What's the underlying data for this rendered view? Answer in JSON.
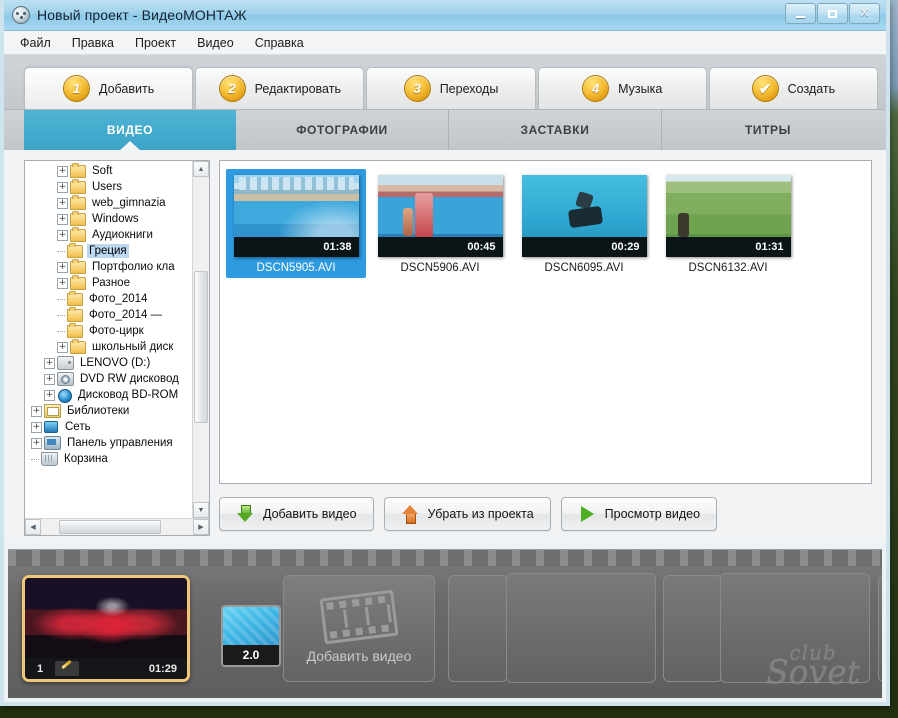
{
  "window": {
    "title": "Новый проект - ВидеоМОНТАЖ",
    "icon": "app-icon",
    "controls": {
      "minimize": "–",
      "maximize": "□",
      "close": "X"
    }
  },
  "menubar": {
    "items": [
      "Файл",
      "Правка",
      "Проект",
      "Видео",
      "Справка"
    ]
  },
  "step_tabs": [
    {
      "num": "1",
      "label": "Добавить",
      "active": true
    },
    {
      "num": "2",
      "label": "Редактировать",
      "active": false
    },
    {
      "num": "3",
      "label": "Переходы",
      "active": false
    },
    {
      "num": "4",
      "label": "Музыка",
      "active": false
    },
    {
      "num": "✔",
      "label": "Создать",
      "active": false
    }
  ],
  "category_tabs": [
    {
      "label": "ВИДЕО",
      "active": true
    },
    {
      "label": "ФОТОГРАФИИ",
      "active": false
    },
    {
      "label": "ЗАСТАВКИ",
      "active": false
    },
    {
      "label": "ТИТРЫ",
      "active": false
    }
  ],
  "tree": {
    "nodes": [
      {
        "label": "Soft",
        "indent": 3,
        "expander": "+",
        "icon": "folder-icon"
      },
      {
        "label": "Users",
        "indent": 3,
        "expander": "+",
        "icon": "folder-icon"
      },
      {
        "label": "web_gimnazia",
        "indent": 3,
        "expander": "+",
        "icon": "folder-icon"
      },
      {
        "label": "Windows",
        "indent": 3,
        "expander": "+",
        "icon": "folder-icon"
      },
      {
        "label": "Аудиокниги",
        "indent": 3,
        "expander": "+",
        "icon": "folder-icon"
      },
      {
        "label": "Греция",
        "indent": 3,
        "expander": "",
        "icon": "folder-icon",
        "selected": true
      },
      {
        "label": "Портфолио кла",
        "indent": 3,
        "expander": "+",
        "icon": "folder-icon"
      },
      {
        "label": "Разное",
        "indent": 3,
        "expander": "+",
        "icon": "folder-icon"
      },
      {
        "label": "Фото_2014",
        "indent": 3,
        "expander": "",
        "icon": "folder-icon"
      },
      {
        "label": "Фото_2014 —",
        "indent": 3,
        "expander": "",
        "icon": "folder-icon"
      },
      {
        "label": "Фото-цирк",
        "indent": 3,
        "expander": "",
        "icon": "folder-icon"
      },
      {
        "label": "школьный диск",
        "indent": 3,
        "expander": "+",
        "icon": "folder-icon"
      },
      {
        "label": "LENOVO (D:)",
        "indent": 2,
        "expander": "+",
        "icon": "drive-icon"
      },
      {
        "label": "DVD RW дисковод",
        "indent": 2,
        "expander": "+",
        "icon": "dvd-drive-icon"
      },
      {
        "label": "Дисковод BD-ROM",
        "indent": 2,
        "expander": "+",
        "icon": "bd-drive-icon"
      },
      {
        "label": "Библиотеки",
        "indent": 1,
        "expander": "+",
        "icon": "libraries-icon"
      },
      {
        "label": "Сеть",
        "indent": 1,
        "expander": "+",
        "icon": "network-icon"
      },
      {
        "label": "Панель управления",
        "indent": 1,
        "expander": "+",
        "icon": "control-panel-icon"
      },
      {
        "label": "Корзина",
        "indent": 1,
        "expander": "",
        "icon": "recycle-bin-icon"
      }
    ]
  },
  "files": [
    {
      "name": "DSCN5905.AVI",
      "duration": "01:38",
      "selected": true,
      "thumb": "pool1"
    },
    {
      "name": "DSCN5906.AVI",
      "duration": "00:45",
      "selected": false,
      "thumb": "pool2"
    },
    {
      "name": "DSCN6095.AVI",
      "duration": "00:29",
      "selected": false,
      "thumb": "pool3"
    },
    {
      "name": "DSCN6132.AVI",
      "duration": "01:31",
      "selected": false,
      "thumb": "field"
    }
  ],
  "actions": [
    {
      "label": "Добавить видео",
      "icon": "arrow-down-icon"
    },
    {
      "label": "Убрать из проекта",
      "icon": "arrow-up-icon"
    },
    {
      "label": "Просмотр видео",
      "icon": "play-icon"
    }
  ],
  "timeline": {
    "clip": {
      "number": "1",
      "duration": "01:29",
      "edit_icon": "pencil-icon"
    },
    "transition": {
      "label": "2.0"
    },
    "add_slot": {
      "label": "Добавить видео",
      "icon": "film-strip-icon"
    },
    "watermark": {
      "line1": "club",
      "line2": "Sovet"
    }
  },
  "colors": {
    "accent": "#3ca4c8",
    "selection": "#2e9ae0",
    "titlebar": "#9fd2ec",
    "clip_border": "#f0c678",
    "badge": "#f7c23c"
  }
}
